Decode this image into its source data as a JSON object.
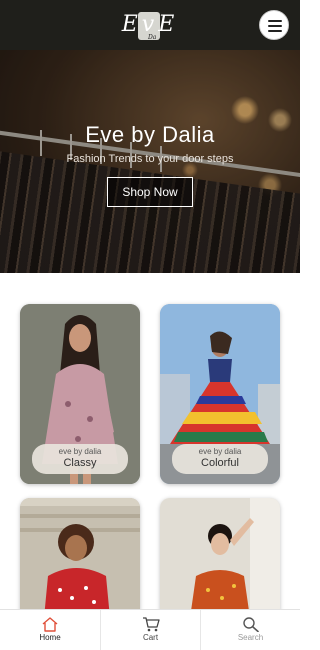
{
  "header": {
    "logo_text": "EvE",
    "logo_small": "Da",
    "menu_icon": "hamburger-menu-icon"
  },
  "hero": {
    "title": "Eve by Dalia",
    "subtitle": "Fashion Trends to your door steps",
    "button": "Shop Now"
  },
  "products": [
    {
      "brand": "eve by dalia",
      "name": "Classy"
    },
    {
      "brand": "eve by dalia",
      "name": "Colorful"
    }
  ],
  "nav": {
    "items": [
      {
        "label": "Home",
        "icon": "home-icon",
        "color": "#e0503a"
      },
      {
        "label": "Cart",
        "icon": "cart-icon",
        "color": "#444444"
      },
      {
        "label": "Search",
        "icon": "search-icon",
        "color": "#999999"
      }
    ]
  }
}
